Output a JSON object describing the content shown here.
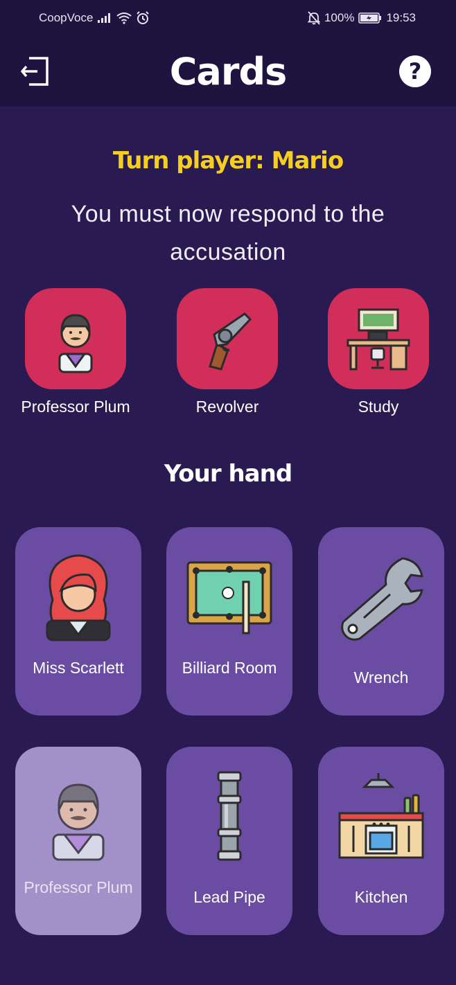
{
  "status_bar": {
    "carrier": "CoopVoce",
    "battery": "100%",
    "time": "19:53"
  },
  "header": {
    "title": "Cards",
    "help_symbol": "?"
  },
  "turn": {
    "player_text": "Turn player: Mario",
    "instruction": "You must now respond to the accusation"
  },
  "accusation": [
    {
      "label": "Professor Plum",
      "icon": "professor-plum-icon"
    },
    {
      "label": "Revolver",
      "icon": "revolver-icon"
    },
    {
      "label": "Study",
      "icon": "study-icon"
    }
  ],
  "hand": {
    "title": "Your hand",
    "cards": [
      {
        "label": "Miss Scarlett",
        "icon": "miss-scarlett-icon"
      },
      {
        "label": "Billiard Room",
        "icon": "billiard-room-icon"
      },
      {
        "label": "Wrench",
        "icon": "wrench-icon"
      },
      {
        "label": "Professor Plum",
        "icon": "professor-plum-icon",
        "selected": true
      },
      {
        "label": "Lead Pipe",
        "icon": "lead-pipe-icon"
      },
      {
        "label": "Kitchen",
        "icon": "kitchen-icon"
      }
    ]
  },
  "colors": {
    "background": "#2a1a52",
    "header": "#1f1440",
    "accent_yellow": "#f5cf1f",
    "accusation_card": "#d22e5a",
    "hand_card": "#6a4ca3",
    "hand_card_selected": "#a290c8"
  }
}
